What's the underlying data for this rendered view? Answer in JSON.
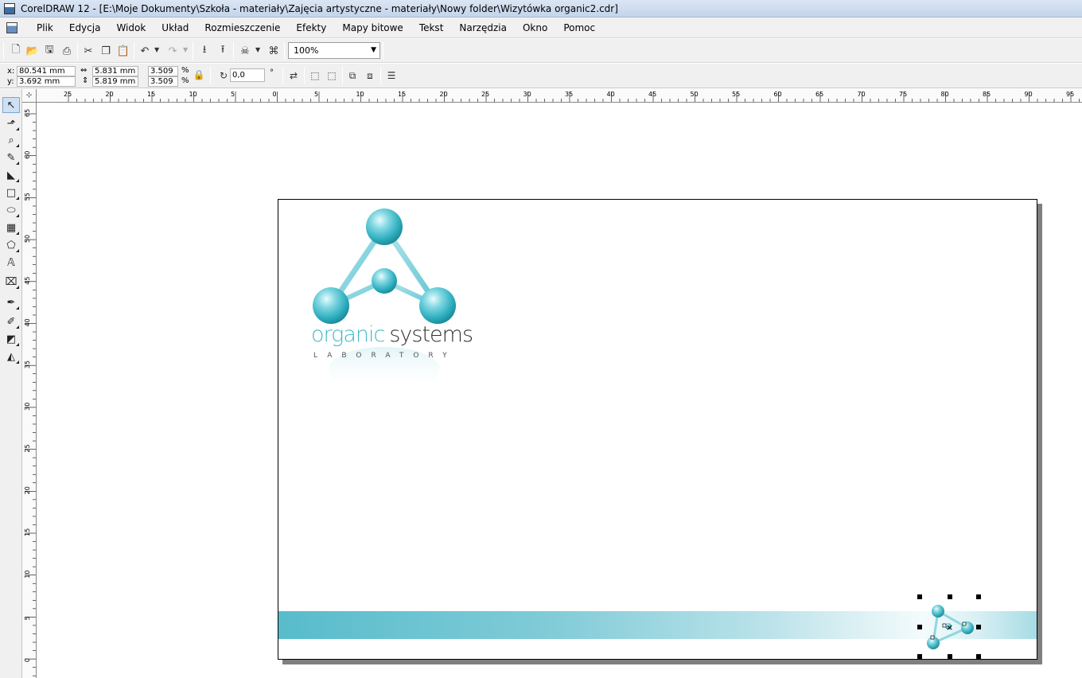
{
  "window": {
    "title": "CorelDRAW 12 - [E:\\Moje Dokumenty\\Szkoła - materiały\\Zajęcia artystyczne - materiały\\Nowy folder\\Wizytówka organic2.cdr]"
  },
  "menu": [
    {
      "label": "Plik"
    },
    {
      "label": "Edycja"
    },
    {
      "label": "Widok"
    },
    {
      "label": "Układ"
    },
    {
      "label": "Rozmieszczenie"
    },
    {
      "label": "Efekty"
    },
    {
      "label": "Mapy bitowe"
    },
    {
      "label": "Tekst"
    },
    {
      "label": "Narzędzia"
    },
    {
      "label": "Okno"
    },
    {
      "label": "Pomoc"
    }
  ],
  "toolbar": {
    "zoom_value": "100%"
  },
  "property_bar": {
    "x_label": "x:",
    "x_value": "80.541 mm",
    "y_label": "y:",
    "y_value": "3.692 mm",
    "width_value": "5.831 mm",
    "height_value": "5.819 mm",
    "scale_x_value": "3.509",
    "scale_y_value": "3.509",
    "percent_symbol": "%",
    "rotation_value": "0,0",
    "degree_symbol": "°"
  },
  "rulers": {
    "horizontal_ticks": [
      "25",
      "20",
      "15",
      "10",
      "5",
      "0",
      "5",
      "10",
      "15",
      "20",
      "25",
      "30",
      "35",
      "40",
      "45",
      "50",
      "55",
      "60",
      "65",
      "70",
      "75",
      "80",
      "85",
      "90",
      "95"
    ],
    "vertical_ticks": [
      "65",
      "60",
      "55",
      "50",
      "45",
      "40",
      "35",
      "30",
      "25",
      "20",
      "15",
      "10",
      "5",
      "0"
    ]
  },
  "document": {
    "logo_word1": "organic",
    "logo_word2": "systems",
    "logo_tagline": "LABORATORY"
  },
  "colors": {
    "accent_teal": "#3fbac8",
    "band_start": "#58bccb"
  }
}
